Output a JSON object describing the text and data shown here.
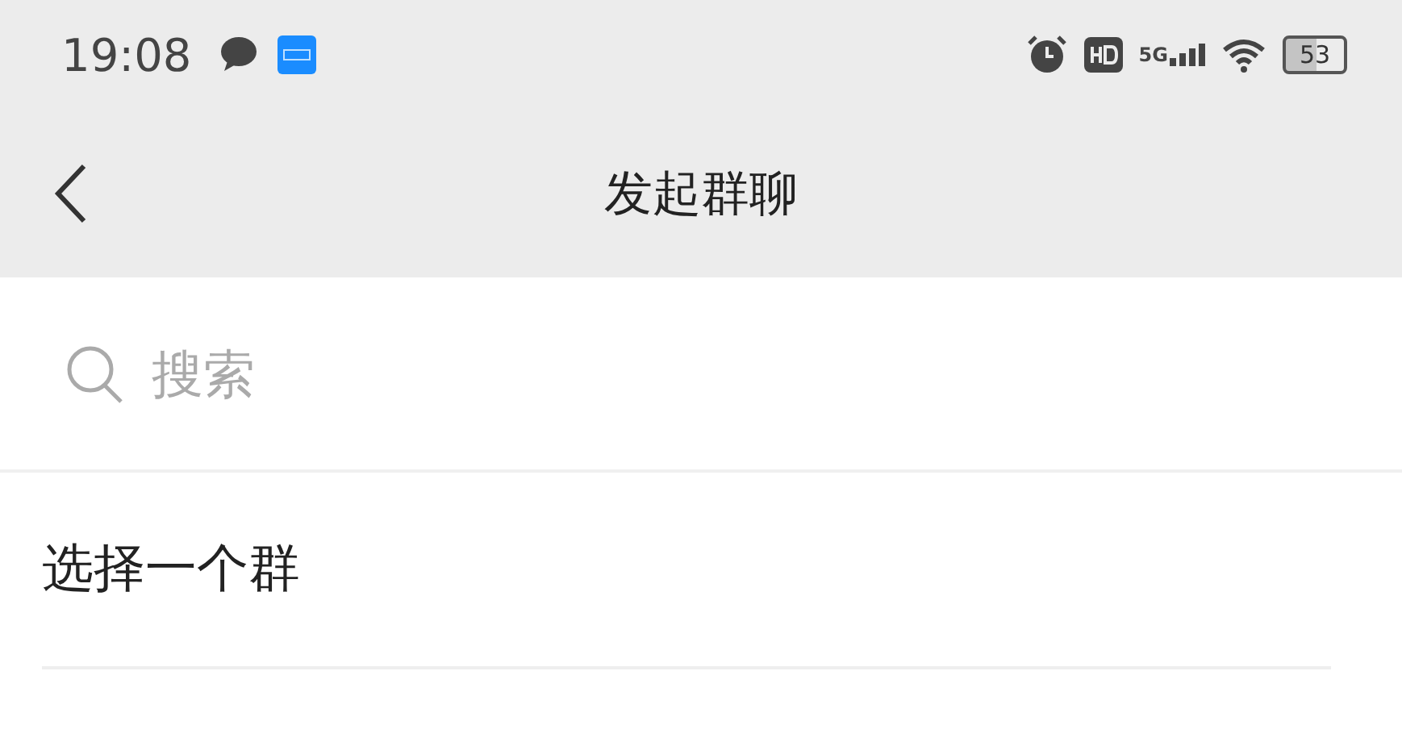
{
  "status_bar": {
    "time": "19:08",
    "network": "5G",
    "battery": "53"
  },
  "header": {
    "title": "发起群聊"
  },
  "search": {
    "placeholder": "搜索"
  },
  "rows": [
    {
      "label": "选择一个群"
    }
  ]
}
